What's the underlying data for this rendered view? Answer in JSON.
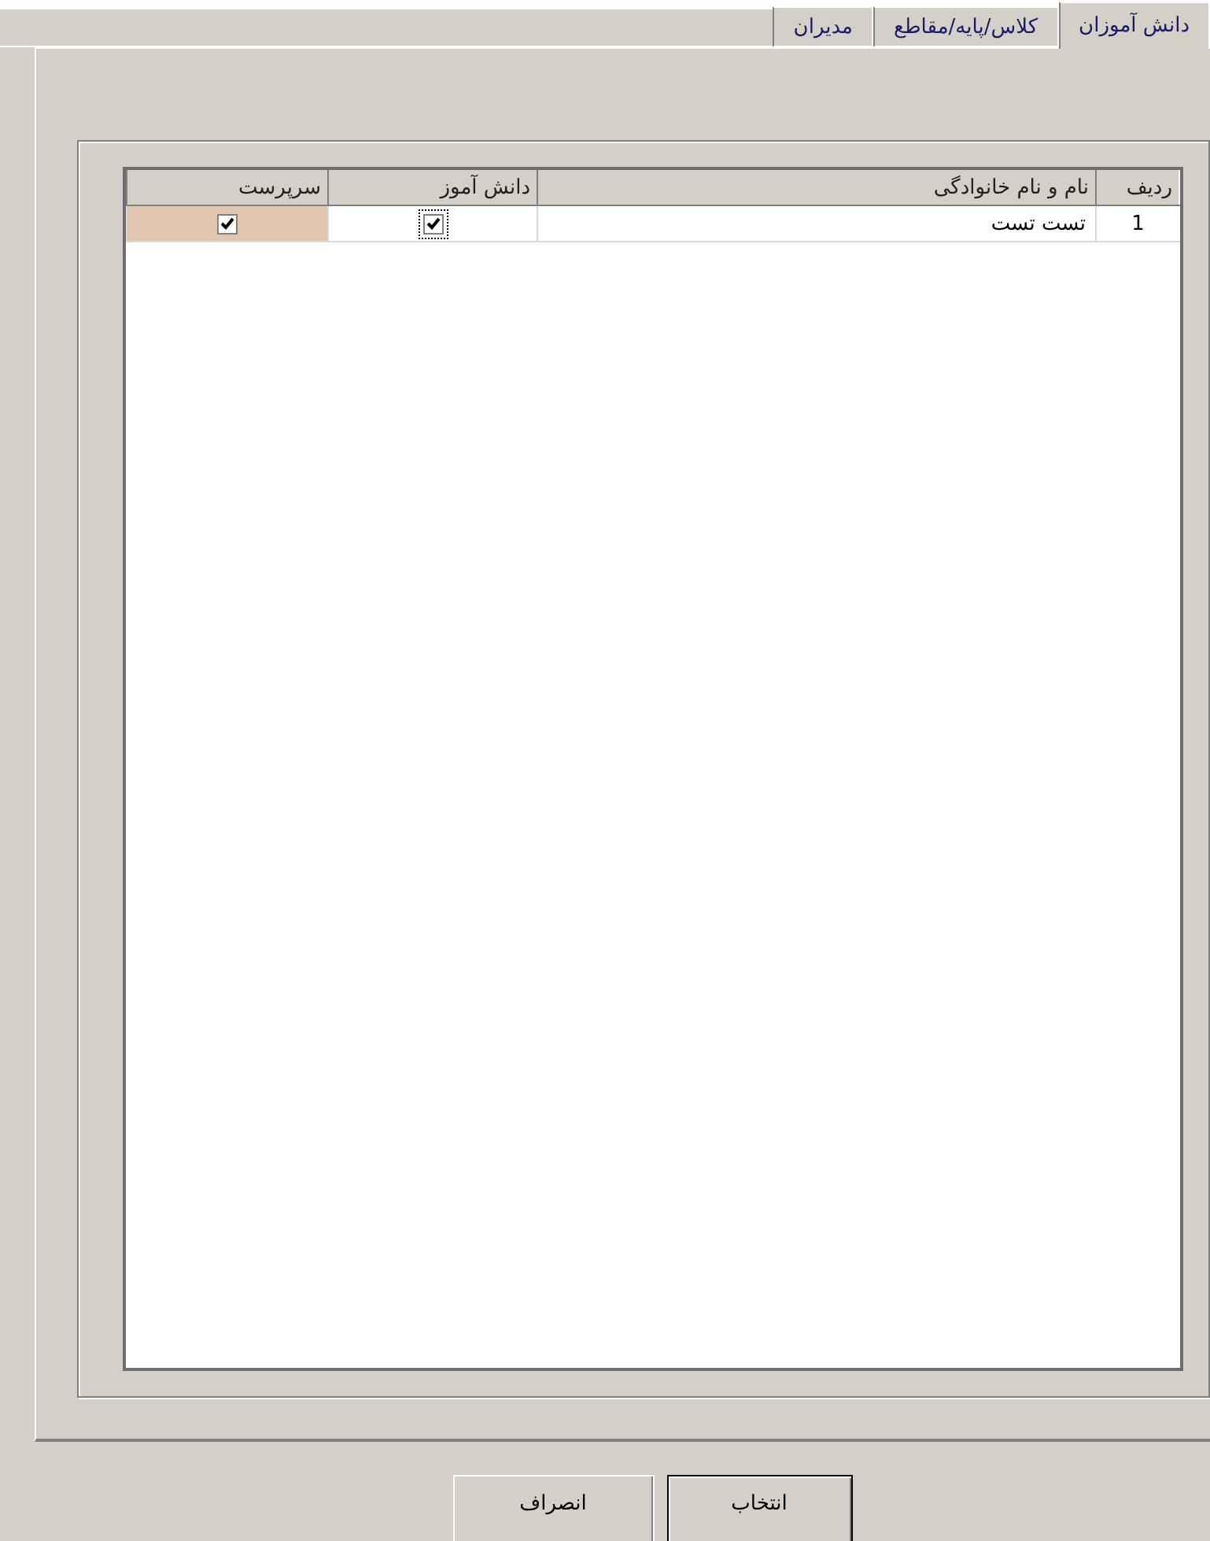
{
  "tabs": [
    {
      "label": "دانش آموزان",
      "selected": true
    },
    {
      "label": "کلاس/پایه/مقاطع",
      "selected": false
    },
    {
      "label": "مدیران",
      "selected": false
    }
  ],
  "table": {
    "columns": [
      "ردیف",
      "نام و نام خانوادگی",
      "دانش آموز",
      "سرپرست"
    ],
    "rows": [
      {
        "number": "1",
        "name": "تست تست",
        "student": {
          "checked": true,
          "focused": true,
          "selected": false
        },
        "guardian": {
          "checked": true,
          "focused": false,
          "selected": true
        }
      }
    ]
  },
  "buttons": [
    {
      "label": "انتخاب",
      "default": true
    },
    {
      "label": "انصراف",
      "default": false
    }
  ]
}
